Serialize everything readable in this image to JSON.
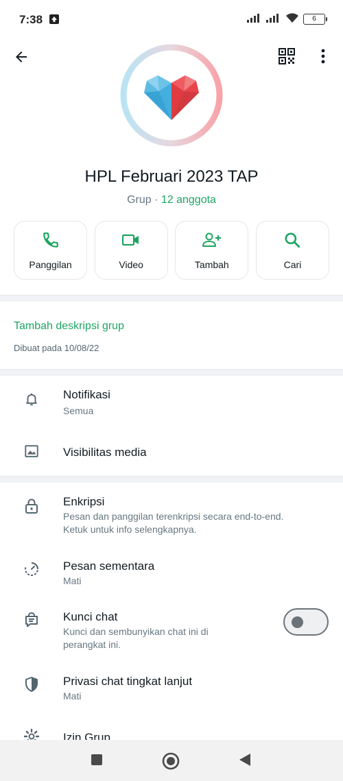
{
  "status_bar": {
    "time": "7:38",
    "battery": "6",
    "icons": [
      "upload-icon",
      "signal-icon",
      "signal-icon",
      "wifi-icon",
      "battery-icon"
    ]
  },
  "toolbar": {
    "back_icon": "arrow-left-icon",
    "qr_icon": "qr-code-icon",
    "more_icon": "more-vert-icon"
  },
  "group": {
    "name": "HPL Februari 2023 TAP",
    "type_label": "Grup",
    "separator": " · ",
    "members": "12 anggota"
  },
  "actions": [
    {
      "label": "Panggilan",
      "icon": "phone-icon"
    },
    {
      "label": "Video",
      "icon": "video-icon"
    },
    {
      "label": "Tambah",
      "icon": "add-person-icon"
    },
    {
      "label": "Cari",
      "icon": "search-icon"
    }
  ],
  "description": {
    "add_label": "Tambah deskripsi grup",
    "created": "Dibuat pada 10/08/22"
  },
  "settings": {
    "notifications": {
      "title": "Notifikasi",
      "subtitle": "Semua"
    },
    "media_visibility": {
      "title": "Visibilitas media"
    },
    "encryption": {
      "title": "Enkripsi",
      "subtitle": "Pesan dan panggilan terenkripsi secara end-to-end. Ketuk untuk info selengkapnya."
    },
    "disappearing": {
      "title": "Pesan sementara",
      "subtitle": "Mati"
    },
    "chat_lock": {
      "title": "Kunci chat",
      "subtitle": "Kunci dan sembunyikan chat ini di perangkat ini.",
      "enabled": false
    },
    "advanced_privacy": {
      "title": "Privasi chat tingkat lanjut",
      "subtitle": "Mati"
    },
    "group_permissions": {
      "title": "Izin Grup"
    }
  },
  "colors": {
    "accent": "#1da462",
    "text_primary": "#111b21",
    "text_secondary": "#667781",
    "heart_blue": "#4fb3e0",
    "heart_red": "#e8444a"
  },
  "nav": {
    "icons": [
      "recents-square-icon",
      "home-circle-icon",
      "back-triangle-icon"
    ]
  }
}
